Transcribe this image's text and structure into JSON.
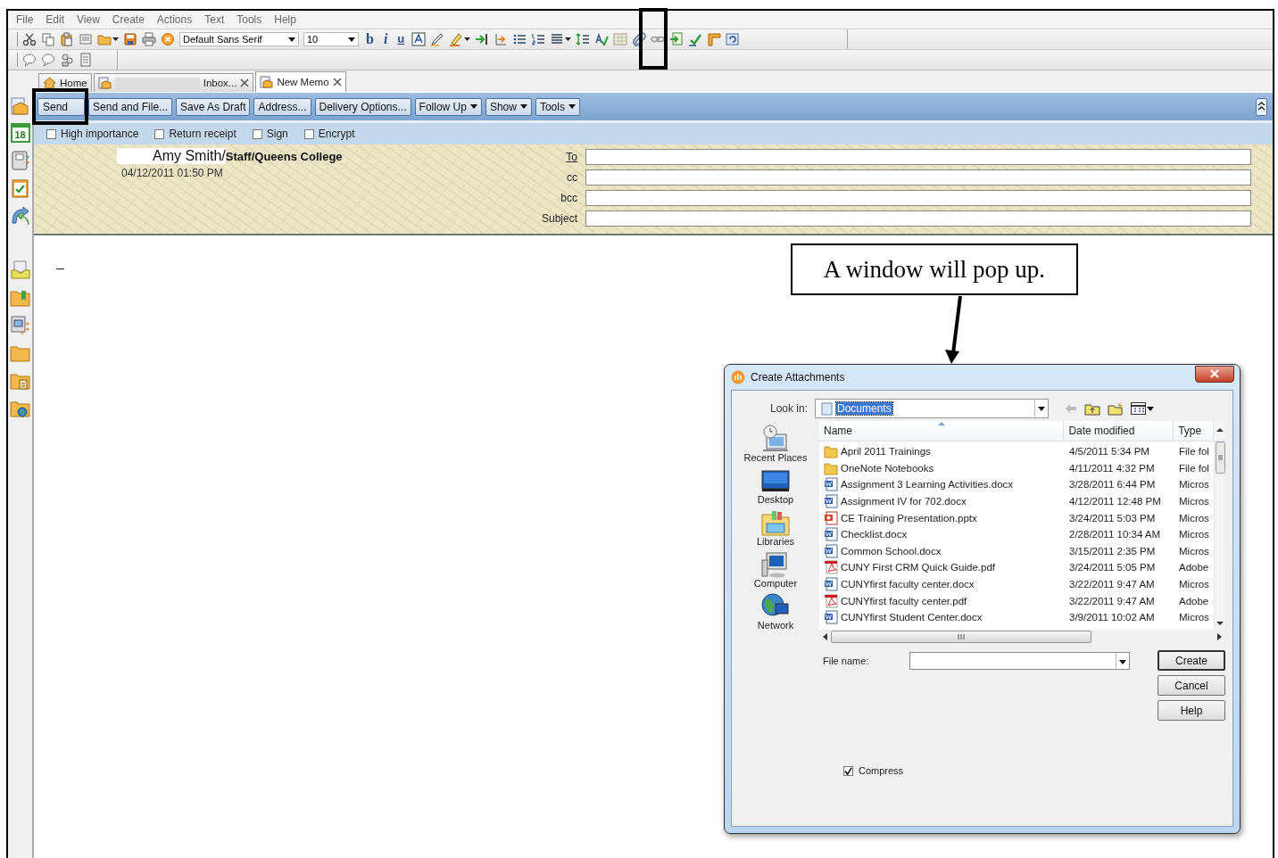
{
  "menu_bar": [
    "File",
    "Edit",
    "View",
    "Create",
    "Actions",
    "Text",
    "Tools",
    "Help"
  ],
  "toolbar": {
    "font": "Default Sans Serif",
    "size": "10",
    "format_buttons": [
      {
        "label": "b",
        "kind": "bold"
      },
      {
        "label": "i",
        "kind": "italic"
      },
      {
        "label": "u",
        "kind": "underline"
      }
    ]
  },
  "sidebar": {
    "calendar_day": "18"
  },
  "tabs": [
    {
      "label": "Home",
      "selected": false,
      "closable": false,
      "redacted": false
    },
    {
      "label": "Inbox...",
      "selected": false,
      "closable": true,
      "redacted": true
    },
    {
      "label": "New Memo",
      "selected": true,
      "closable": true,
      "redacted": false
    }
  ],
  "actions": [
    {
      "label": "Send",
      "kind": "plain"
    },
    {
      "label": "Send and File...",
      "kind": "plain"
    },
    {
      "label": "Save As Draft",
      "kind": "plain"
    },
    {
      "label": "Address...",
      "kind": "plain"
    },
    {
      "label": "Delivery Options...",
      "kind": "plain"
    },
    {
      "label": "Follow Up",
      "kind": "menu"
    },
    {
      "label": "Show",
      "kind": "menu"
    },
    {
      "label": "Tools",
      "kind": "menu"
    }
  ],
  "options": [
    {
      "label": "High importance",
      "checked": false
    },
    {
      "label": "Return receipt",
      "checked": false
    },
    {
      "label": "Sign",
      "checked": false
    },
    {
      "label": "Encrypt",
      "checked": false
    }
  ],
  "header": {
    "sender": "Amy Smith/",
    "sender_org": "Staff/Queens College",
    "date": "04/12/2011 01:50 PM",
    "fields": [
      {
        "label": "To",
        "kind": "link"
      },
      {
        "label": "cc",
        "kind": "plain"
      },
      {
        "label": "bcc",
        "kind": "plain"
      },
      {
        "label": "Subject",
        "kind": "plain"
      }
    ]
  },
  "body": {
    "text": "–"
  },
  "callout": {
    "text": "A window will pop up."
  },
  "dialog": {
    "title": "Create Attachments",
    "look_in_label": "Look in:",
    "look_in_value": "Documents",
    "places": [
      {
        "label": "Recent Places",
        "kind": "recent"
      },
      {
        "label": "Desktop",
        "kind": "desktop"
      },
      {
        "label": "Libraries",
        "kind": "libraries"
      },
      {
        "label": "Computer",
        "kind": "computer"
      },
      {
        "label": "Network",
        "kind": "network"
      }
    ],
    "columns": [
      "Name",
      "Date modified",
      "Type"
    ],
    "files": [
      {
        "name": "April 2011 Trainings",
        "kind": "folder",
        "date": "4/5/2011 5:34 PM",
        "type": "File fol"
      },
      {
        "name": "OneNote Notebooks",
        "kind": "folder",
        "date": "4/11/2011 4:32 PM",
        "type": "File fol"
      },
      {
        "name": "Assignment 3 Learning Activities.docx",
        "kind": "word",
        "date": "3/28/2011 6:44 PM",
        "type": "Micros"
      },
      {
        "name": "Assignment IV for 702.docx",
        "kind": "word",
        "date": "4/12/2011 12:48 PM",
        "type": "Micros"
      },
      {
        "name": "CE Training Presentation.pptx",
        "kind": "slides",
        "date": "3/24/2011 5:03 PM",
        "type": "Micros"
      },
      {
        "name": "Checklist.docx",
        "kind": "word",
        "date": "2/28/2011 10:34 AM",
        "type": "Micros"
      },
      {
        "name": "Common School.docx",
        "kind": "word",
        "date": "3/15/2011 2:35 PM",
        "type": "Micros"
      },
      {
        "name": "CUNY First CRM Quick Guide.pdf",
        "kind": "pdf",
        "date": "3/24/2011 5:05 PM",
        "type": "Adobe"
      },
      {
        "name": "CUNYfirst faculty center.docx",
        "kind": "word",
        "date": "3/22/2011 9:47 AM",
        "type": "Micros"
      },
      {
        "name": "CUNYfirst faculty center.pdf",
        "kind": "pdf",
        "date": "3/22/2011 9:47 AM",
        "type": "Adobe"
      },
      {
        "name": "CUNYfirst Student Center.docx",
        "kind": "word",
        "date": "3/9/2011 10:02 AM",
        "type": "Micros"
      }
    ],
    "file_name_label": "File name:",
    "buttons": [
      "Create",
      "Cancel",
      "Help"
    ],
    "compress": {
      "label": "Compress",
      "checked": true
    }
  }
}
